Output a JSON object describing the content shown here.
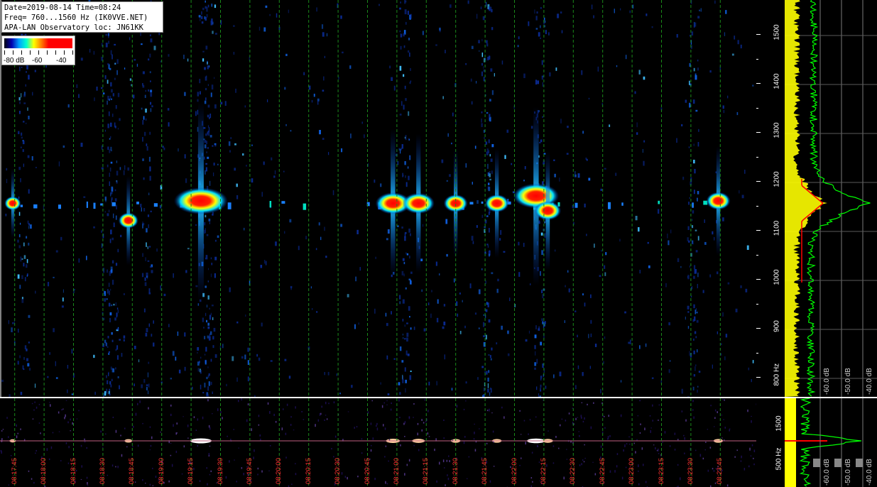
{
  "header": {
    "line1": "Date=2019-08-14 Time=08:24",
    "line2": "Freq= 760...1560 Hz (IK0VVE.NET)",
    "line3": "APA-LAN Observatory loc: JN61KK"
  },
  "color_scale": {
    "labels": [
      "-80 dB",
      "-60",
      "-40"
    ],
    "colors": [
      "#000010",
      "#0000b0",
      "#00a0ff",
      "#00ffd0",
      "#ffff00",
      "#ff8000",
      "#ff0000"
    ]
  },
  "freq_axis": {
    "labels": [
      "1500",
      "1400",
      "1300",
      "1200",
      "1100",
      "1000",
      "900",
      "800 Hz"
    ],
    "values": [
      1500,
      1400,
      1300,
      1200,
      1100,
      1000,
      900,
      800
    ],
    "range": [
      760,
      1570
    ]
  },
  "lower_freq_axis": {
    "labels": [
      "1500",
      "500 Hz"
    ]
  },
  "time_axis": {
    "labels": [
      "08:17:45",
      "08:18:00",
      "08:18:15",
      "08:18:30",
      "08:18:45",
      "08:19:00",
      "08:19:15",
      "08:19:30",
      "08:19:45",
      "08:20:00",
      "08:20:15",
      "08:20:30",
      "08:20:45",
      "08:21:00",
      "08:21:15",
      "08:21:30",
      "08:21:45",
      "08:22:00",
      "08:22:15",
      "08:22:30",
      "08:22:45",
      "08:23:00",
      "08:23:15",
      "08:23:30",
      "08:23:45"
    ]
  },
  "spectrum_axis": {
    "labels": [
      "-60.0 dB",
      "-50.0 dB",
      "-40.0 dB"
    ]
  },
  "lower_spectrum_axis": {
    "labels": [
      "-60.0 dB",
      "-50.0 dB",
      "-40.0 dB"
    ]
  },
  "colors": {
    "grid_green": "#1a8a1a",
    "time_label": "#ff3030",
    "yellow_trace": "#ffff00",
    "green_trace": "#00ff00",
    "red_trace": "#ff0000"
  },
  "chart_data": {
    "type": "heatmap",
    "title": "",
    "x_labels": [
      "08:17:45",
      "08:18:00",
      "08:18:15",
      "08:18:30",
      "08:18:45",
      "08:19:00",
      "08:19:15",
      "08:19:30",
      "08:19:45",
      "08:20:00",
      "08:20:15",
      "08:20:30",
      "08:20:45",
      "08:21:00",
      "08:21:15",
      "08:21:30",
      "08:21:45",
      "08:22:00",
      "08:22:15",
      "08:22:30",
      "08:22:45",
      "08:23:00",
      "08:23:15",
      "08:23:30",
      "08:23:45"
    ],
    "y_labels": [
      "1500",
      "1400",
      "1300",
      "1200",
      "1100",
      "1000",
      "900",
      "800 Hz"
    ],
    "y_range_hz": [
      760,
      1570
    ],
    "carrier_hz": 1155,
    "events": [
      {
        "time": "08:17:44",
        "hz": 1155,
        "strength": 0.35
      },
      {
        "time": "08:18:43",
        "hz": 1120,
        "strength": 0.45
      },
      {
        "time": "08:19:20",
        "hz": 1160,
        "strength": 1.0
      },
      {
        "time": "08:20:58",
        "hz": 1155,
        "strength": 0.75
      },
      {
        "time": "08:21:11",
        "hz": 1155,
        "strength": 0.7
      },
      {
        "time": "08:21:30",
        "hz": 1155,
        "strength": 0.55
      },
      {
        "time": "08:21:51",
        "hz": 1155,
        "strength": 0.55
      },
      {
        "time": "08:22:11",
        "hz": 1170,
        "strength": 0.9
      },
      {
        "time": "08:22:17",
        "hz": 1140,
        "strength": 0.6
      },
      {
        "time": "08:23:44",
        "hz": 1160,
        "strength": 0.55
      }
    ]
  }
}
